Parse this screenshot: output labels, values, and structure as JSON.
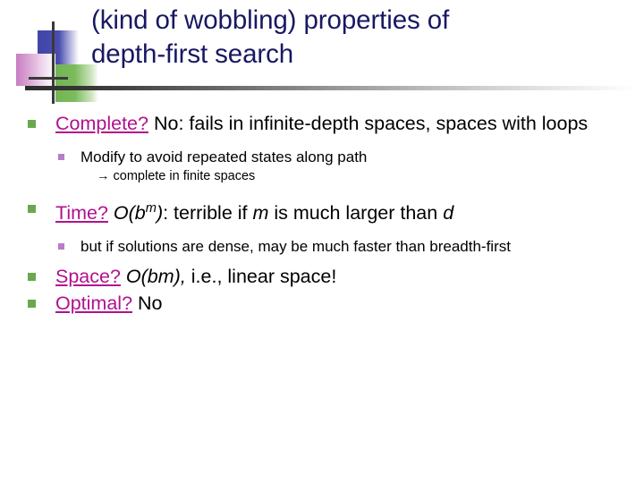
{
  "slide": {
    "title_line1": "(kind of wobbling) properties of",
    "title_line2": "depth-first search",
    "title_color": "#181863",
    "link_color": "#b0118e",
    "bullet_level1_color": "#6aa84f",
    "bullet_level2_color": "#b87cc8",
    "background_color": "#ffffff"
  },
  "content": {
    "complete": {
      "label": "Complete?",
      "text": " No: fails in infinite-depth spaces, spaces with loops",
      "sub": {
        "text": "Modify to avoid repeated states along path",
        "note": "→ complete in finite spaces"
      }
    },
    "time": {
      "label": "Time?",
      "formula_prefix": "O(b",
      "formula_sup": "m",
      "formula_suffix": ")",
      "text_a": ": terrible if ",
      "var_m": "m",
      "text_b": " is much larger than ",
      "var_d": "d",
      "sub": {
        "text": " but if solutions are dense, may be much faster than breadth-first"
      }
    },
    "space": {
      "label": "Space?",
      "formula": "O(bm),",
      "text": " i.e., linear space!"
    },
    "optimal": {
      "label": "Optimal?",
      "text": " No"
    }
  },
  "icons": {
    "logo_blue_square": "blue-square",
    "logo_green_square": "green-square",
    "logo_pink_square": "pink-square",
    "logo_vertical_line": "vertical-line",
    "logo_horizontal_line": "horizontal-line"
  }
}
